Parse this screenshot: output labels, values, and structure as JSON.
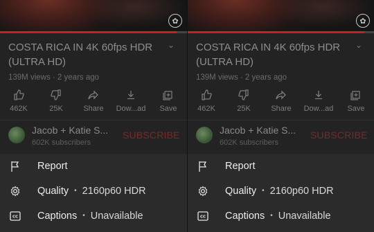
{
  "video": {
    "title": "COSTA RICA IN 4K 60fps HDR (ULTRA HD)",
    "meta": "139M views · 2 years ago"
  },
  "actions": [
    {
      "icon": "thumbs-up-icon",
      "label": "462K"
    },
    {
      "icon": "thumbs-down-icon",
      "label": "25K"
    },
    {
      "icon": "share-icon",
      "label": "Share"
    },
    {
      "icon": "download-icon",
      "label": "Dow...ad"
    },
    {
      "icon": "save-icon",
      "label": "Save"
    }
  ],
  "channel": {
    "name": "Jacob + Katie S...",
    "subscribers": "602K subscribers",
    "subscribe_label": "SUBSCRIBE"
  },
  "menu": {
    "report": "Report",
    "quality": "Quality",
    "quality_value": "2160p60 HDR",
    "captions": "Captions",
    "captions_value": "Unavailable",
    "separator": "•"
  },
  "colors": {
    "accent_red": "#cc1f1f",
    "sheet_bg": "#2b2b2b"
  }
}
